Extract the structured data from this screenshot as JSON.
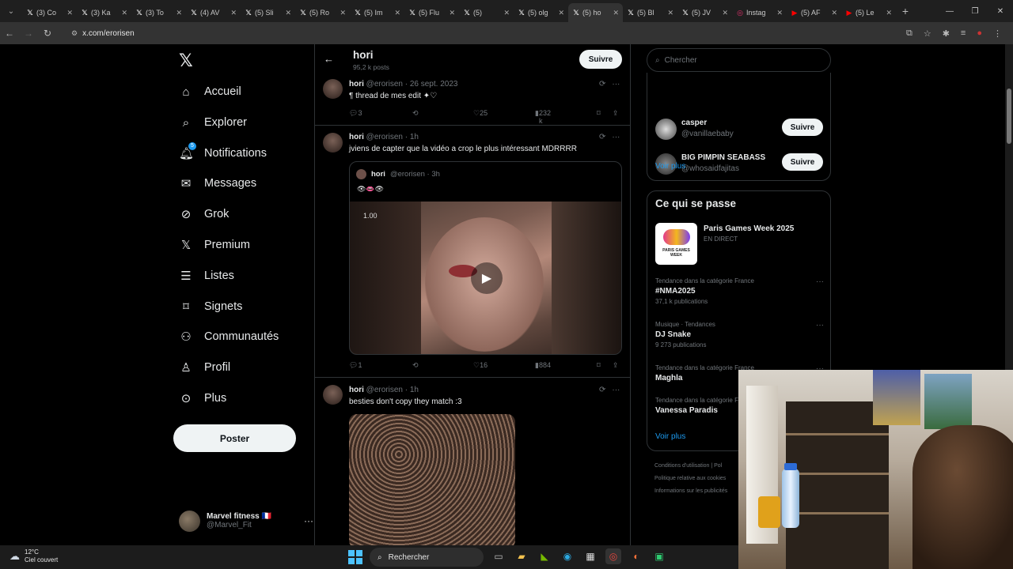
{
  "browser": {
    "tabs": [
      {
        "label": "(3) Co",
        "icon": "x-logo"
      },
      {
        "label": "(3) Ka",
        "icon": "x-logo"
      },
      {
        "label": "(3) To",
        "icon": "x-logo"
      },
      {
        "label": "(4) AV",
        "icon": "x-logo"
      },
      {
        "label": "(5) Sli",
        "icon": "x-logo"
      },
      {
        "label": "(5) Ro",
        "icon": "x-logo"
      },
      {
        "label": "(5) Im",
        "icon": "x-logo"
      },
      {
        "label": "(5) Flu",
        "icon": "x-logo"
      },
      {
        "label": "(5)",
        "icon": "x-logo"
      },
      {
        "label": "(5) olg",
        "icon": "x-logo"
      },
      {
        "label": "(5) ho",
        "icon": "x-logo",
        "active": true
      },
      {
        "label": "(5) Bl",
        "icon": "x-logo"
      },
      {
        "label": "(5) JV",
        "icon": "x-logo"
      },
      {
        "label": "Instag",
        "icon": "instagram-logo"
      },
      {
        "label": "(5) AF",
        "icon": "youtube-logo"
      },
      {
        "label": "(5) Le",
        "icon": "youtube-logo"
      }
    ],
    "url": "x.com/erorisen"
  },
  "leftnav": {
    "items": [
      {
        "label": "Accueil",
        "icon": "home-icon"
      },
      {
        "label": "Explorer",
        "icon": "search-icon"
      },
      {
        "label": "Notifications",
        "icon": "bell-icon",
        "badge": "5"
      },
      {
        "label": "Messages",
        "icon": "mail-icon"
      },
      {
        "label": "Grok",
        "icon": "grok-icon"
      },
      {
        "label": "Premium",
        "icon": "x-logo-icon"
      },
      {
        "label": "Listes",
        "icon": "list-icon"
      },
      {
        "label": "Signets",
        "icon": "bookmark-icon"
      },
      {
        "label": "Communautés",
        "icon": "people-icon"
      },
      {
        "label": "Profil",
        "icon": "person-icon"
      },
      {
        "label": "Plus",
        "icon": "more-circle-icon"
      }
    ],
    "post_label": "Poster",
    "account": {
      "name": "Marvel fitness 🇫🇷",
      "handle": "@Marvel_Fit"
    }
  },
  "timeline": {
    "title": "hori",
    "subtitle": "95,2 k posts",
    "follow_label": "Suivre",
    "tweets": [
      {
        "name": "hori",
        "meta": "@erorisen · 26 sept. 2023",
        "text": "¶ thread de mes edit ✦♡",
        "replies": "3",
        "likes": "25",
        "views": "232 k"
      },
      {
        "name": "hori",
        "meta": "@erorisen · 1h",
        "text": "jviens de capter que la vidéo a crop le plus intéressant MDRRRR",
        "quote": {
          "name": "hori",
          "meta": "@erorisen · 3h",
          "text": "👁👄👁",
          "speed": "1.00"
        },
        "replies": "1",
        "likes": "16",
        "views": "884"
      },
      {
        "name": "hori",
        "meta": "@erorisen · 1h",
        "text": "besties don't copy they match :3"
      }
    ]
  },
  "rightcol": {
    "search_placeholder": "Chercher",
    "suggestions": [
      {
        "name": "casper",
        "handle": "@vanillaebaby",
        "button": "Suivre"
      },
      {
        "name": "BIG PIMPIN SEABASS",
        "handle": "@whosaidfajitas",
        "button": "Suivre"
      }
    ],
    "voir_plus": "Voir plus",
    "happening_title": "Ce qui se passe",
    "event": {
      "title": "Paris Games Week 2025",
      "sub": "EN DIRECT",
      "image_text": "PARIS GAMES WEEK"
    },
    "trends": [
      {
        "category": "Tendance dans la catégorie France",
        "name": "#NMA2025",
        "count": "37,1 k publications"
      },
      {
        "category": "Musique · Tendances",
        "name": "DJ Snake",
        "count": "9 273 publications"
      },
      {
        "category": "Tendance dans la catégorie France",
        "name": "Maghla",
        "count": ""
      },
      {
        "category": "Tendance dans la catégorie France",
        "name": "Vanessa Paradis",
        "count": ""
      }
    ],
    "voir_plus2": "Voir plus",
    "footer": [
      "Conditions d'utilisation  |  Pol",
      "Politique relative aux cookies",
      "Informations sur les publicités"
    ]
  },
  "taskbar": {
    "temp": "12°C",
    "weather": "Ciel couvert",
    "search": "Rechercher"
  },
  "colors": {
    "accent": "#1d9bf0",
    "bg": "#000000",
    "border": "#2f3336",
    "muted": "#71767b"
  }
}
